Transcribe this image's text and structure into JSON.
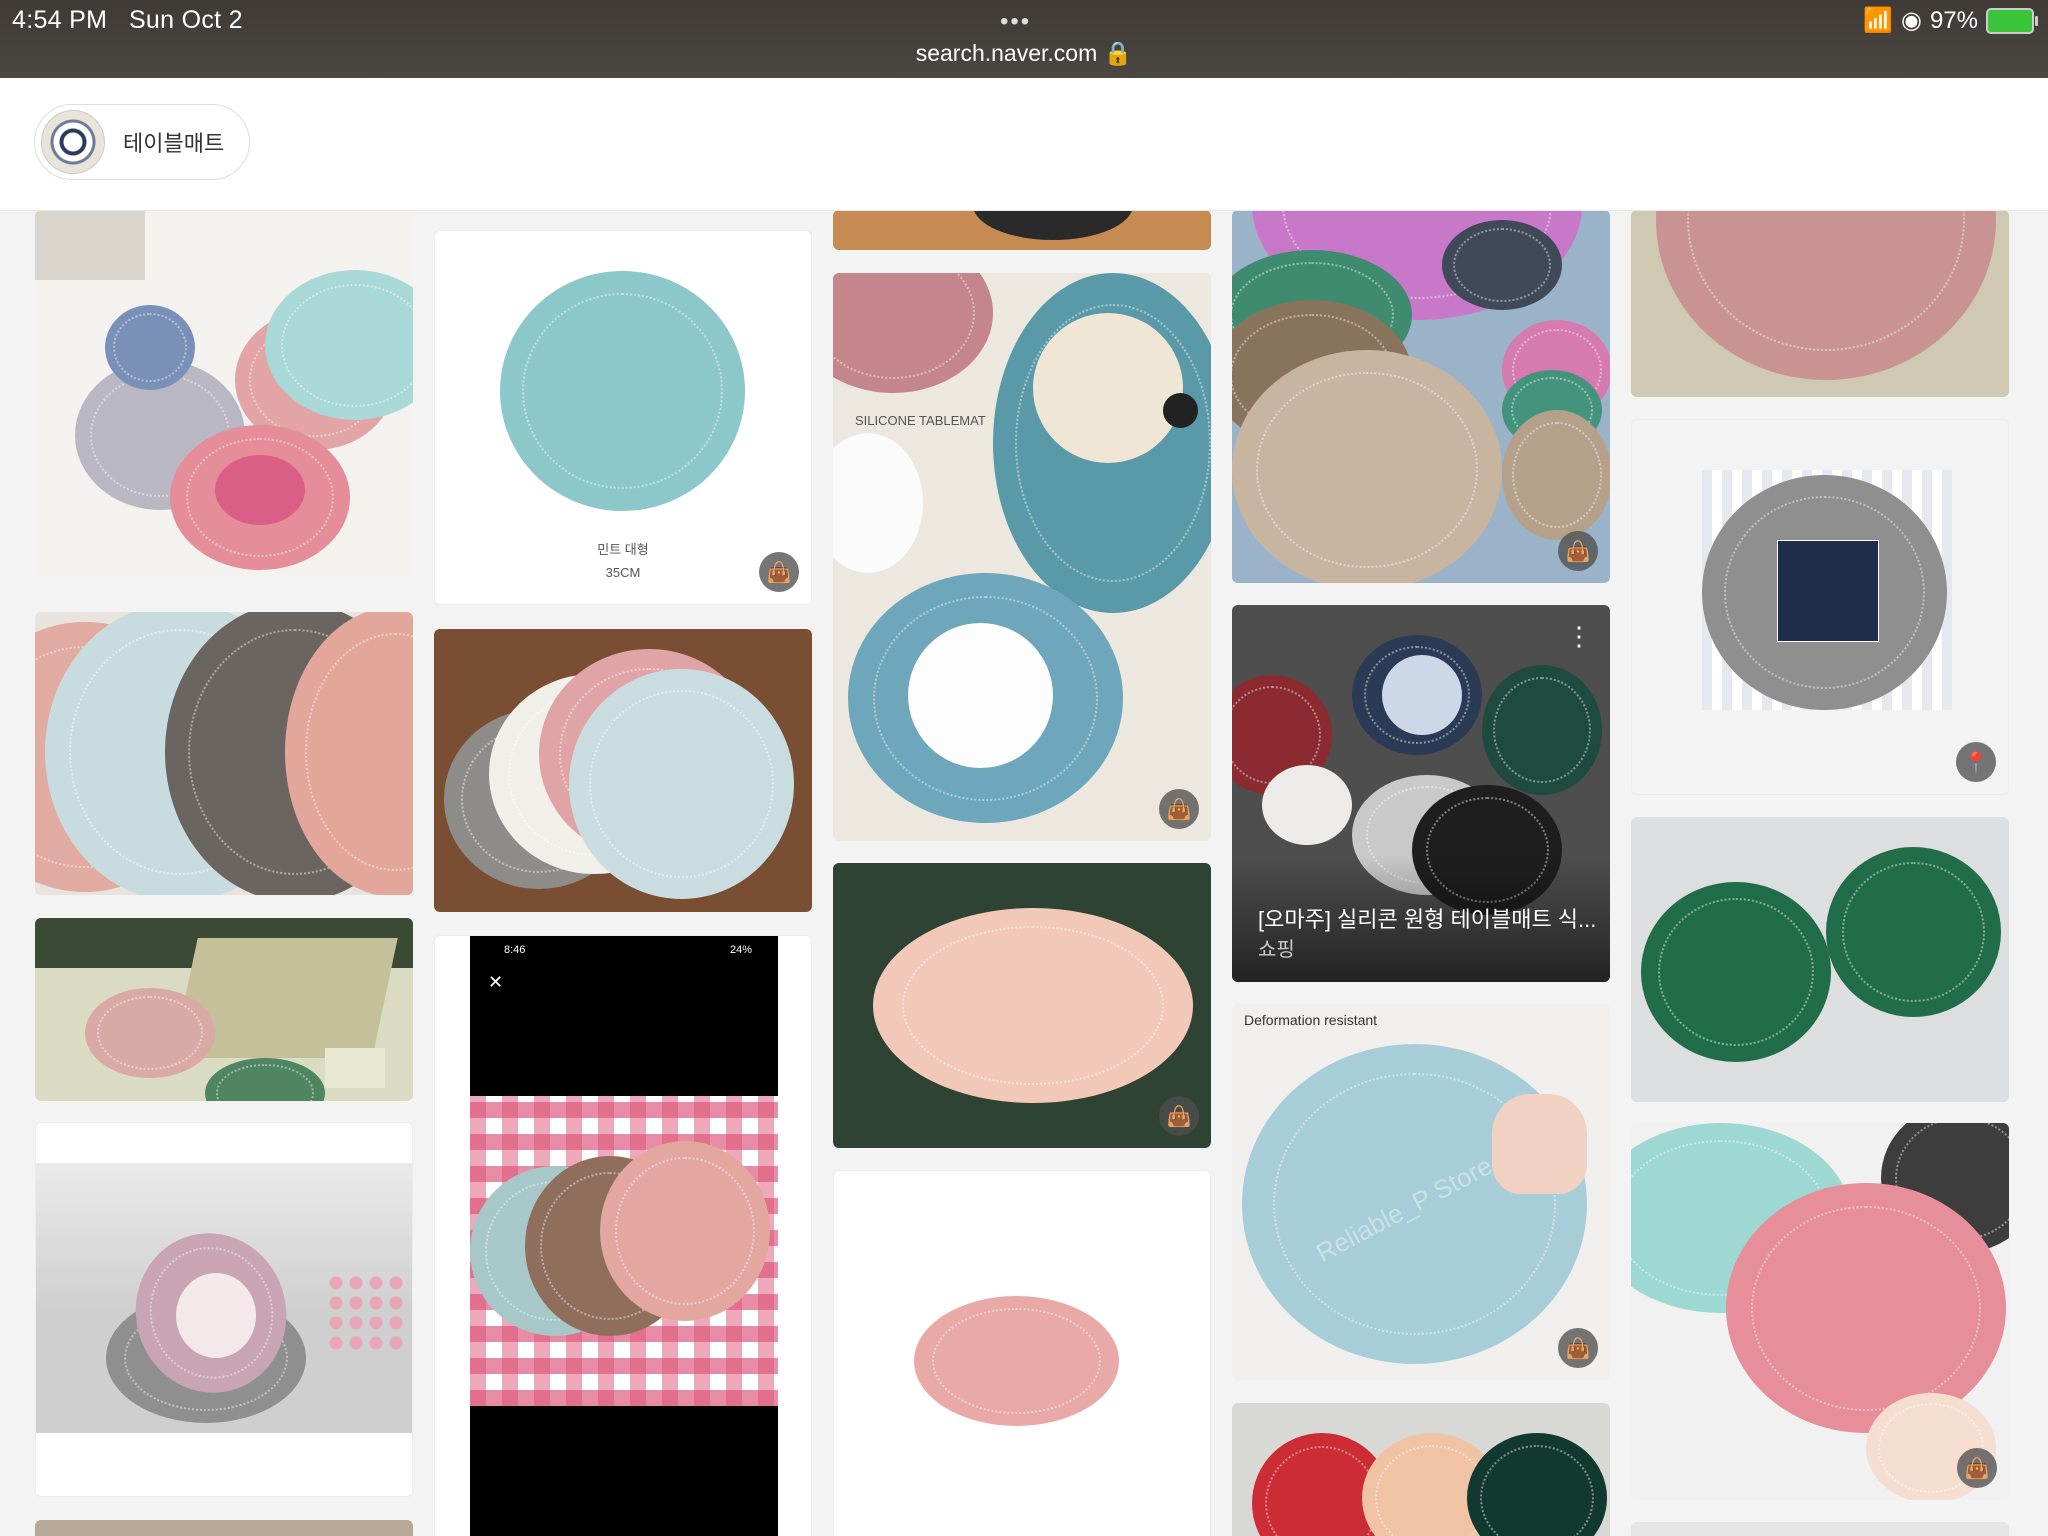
{
  "status_bar": {
    "time": "4:54 PM",
    "date": "Sun Oct 2",
    "url": "search.naver.com",
    "battery": "97%"
  },
  "search_chip": {
    "label": "테이블매트"
  },
  "cards": {
    "mint": {
      "caption_line1": "민트 대형",
      "caption_line2": "35CM"
    },
    "silicone": {
      "label": "SILICONE TABLEMAT"
    },
    "omaju": {
      "title": "[오마주] 실리콘 원형 테이블매트 식...",
      "subtitle": "쇼핑"
    },
    "deformation": {
      "label": "Deformation resistant",
      "watermark": "Reliable_P Store"
    },
    "phone": {
      "time": "8:46",
      "battery": "24%"
    }
  },
  "colors": {
    "accent": "#3ac43a",
    "mint": "#8cc7c9",
    "pink": "#e2a4a4"
  }
}
